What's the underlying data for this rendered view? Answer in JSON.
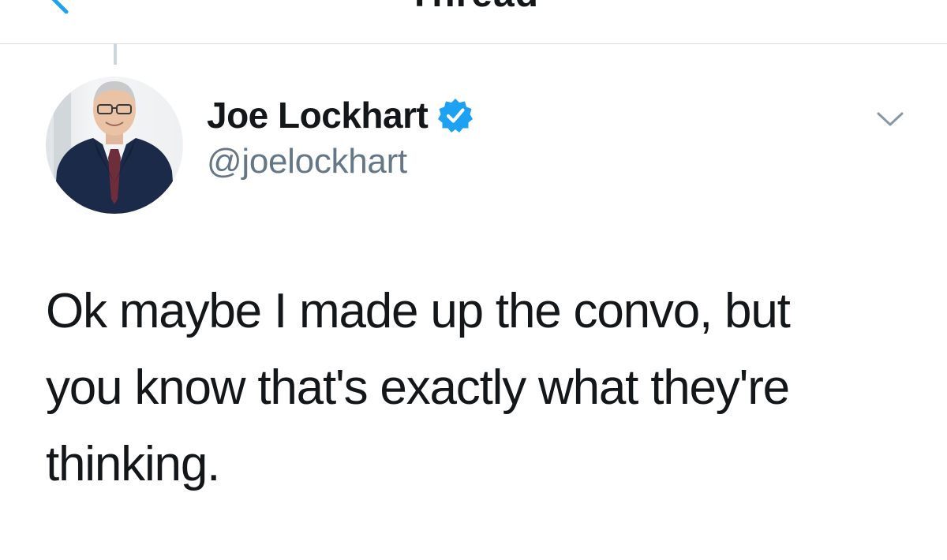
{
  "nav": {
    "title": "Thread",
    "back_icon": "chevron-left-icon"
  },
  "tweet": {
    "author": {
      "display_name": "Joe Lockhart",
      "handle": "@joelockhart",
      "verified": true,
      "verified_icon": "verified-badge-icon"
    },
    "menu_icon": "chevron-down-icon",
    "text": "Ok maybe I made up the convo, but\nyou know that's exactly what they're\nthinking."
  },
  "colors": {
    "accent": "#1da1f2",
    "text_primary": "#14171a",
    "text_secondary": "#657786",
    "divider": "#d8dde1",
    "thread_line": "#ccd6dd"
  }
}
